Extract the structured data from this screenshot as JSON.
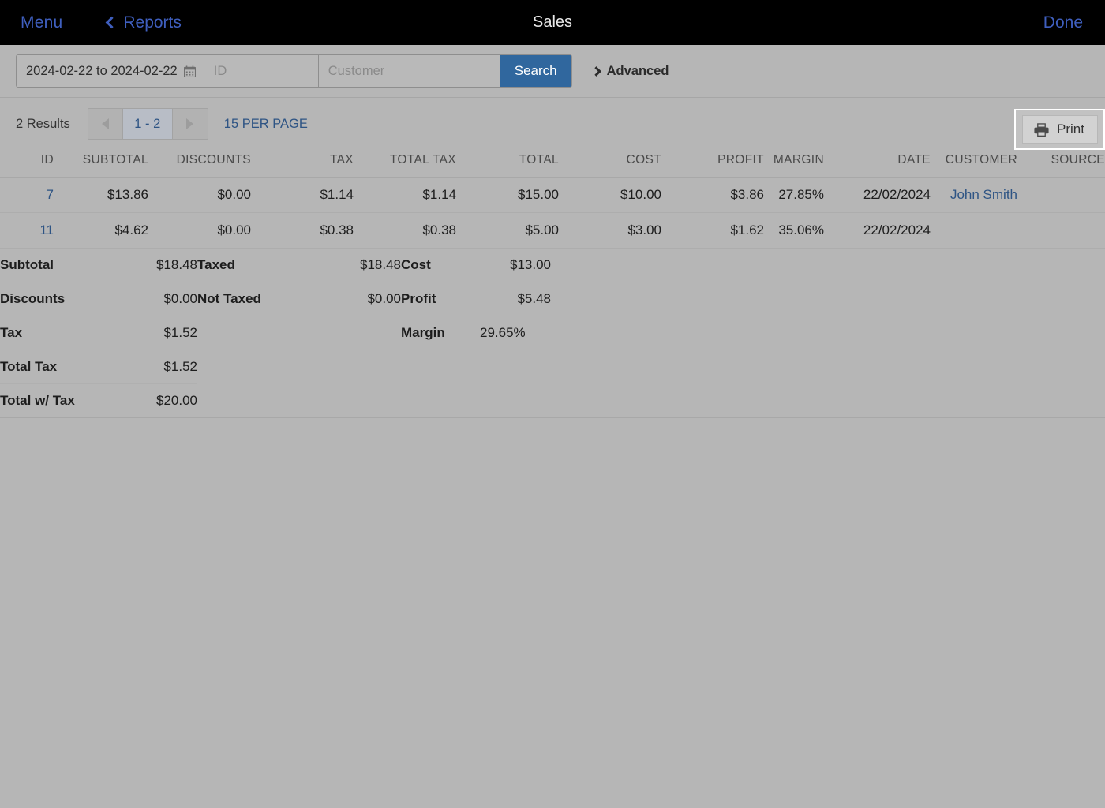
{
  "navbar": {
    "menu_label": "Menu",
    "back_label": "Reports",
    "back_icon": "chevron-left-icon",
    "title": "Sales",
    "done_label": "Done"
  },
  "search": {
    "date_range": "2024-02-22 to 2024-02-22",
    "calendar_icon": "calendar-icon",
    "id_value": "",
    "id_placeholder": "ID",
    "customer_value": "",
    "customer_placeholder": "Customer",
    "search_label": "Search",
    "advanced_label": "Advanced",
    "advanced_icon": "chevron-right-icon"
  },
  "toolbar": {
    "results_label": "2 Results",
    "prev_icon": "triangle-left-icon",
    "page_range": "1 - 2",
    "next_icon": "triangle-right-icon",
    "per_page_label": "15 PER PAGE",
    "print_label": "Print",
    "print_icon": "printer-icon"
  },
  "table": {
    "columns": [
      "ID",
      "SUBTOTAL",
      "DISCOUNTS",
      "TAX",
      "TOTAL TAX",
      "TOTAL",
      "COST",
      "PROFIT",
      "MARGIN",
      "DATE",
      "CUSTOMER",
      "SOURCE"
    ],
    "rows": [
      {
        "id": "7",
        "subtotal": "$13.86",
        "discounts": "$0.00",
        "tax": "$1.14",
        "total_tax": "$1.14",
        "total": "$15.00",
        "cost": "$10.00",
        "profit": "$3.86",
        "margin": "27.85%",
        "date": "22/02/2024",
        "customer": "John Smith",
        "source": ""
      },
      {
        "id": "11",
        "subtotal": "$4.62",
        "discounts": "$0.00",
        "tax": "$0.38",
        "total_tax": "$0.38",
        "total": "$5.00",
        "cost": "$3.00",
        "profit": "$1.62",
        "margin": "35.06%",
        "date": "22/02/2024",
        "customer": "",
        "source": ""
      }
    ]
  },
  "summary": {
    "col1": [
      {
        "label": "Subtotal",
        "value": "$18.48"
      },
      {
        "label": "Discounts",
        "value": "$0.00"
      },
      {
        "label": "Tax",
        "value": "$1.52"
      },
      {
        "label": "Total Tax",
        "value": "$1.52"
      },
      {
        "label": "Total w/ Tax",
        "value": "$20.00"
      }
    ],
    "col2": [
      {
        "label": "Taxed",
        "value": "$18.48"
      },
      {
        "label": "Not Taxed",
        "value": "$0.00"
      }
    ],
    "col3": [
      {
        "label": "Cost",
        "value": "$13.00"
      },
      {
        "label": "Profit",
        "value": "$5.48"
      },
      {
        "label": "Margin",
        "value": "29.65%"
      }
    ]
  },
  "colors": {
    "accent_blue": "#30679e",
    "link_blue": "#2e5484",
    "nav_blue": "#3f5fbf",
    "page_bg": "#b6b6b6",
    "nav_bg": "#000000"
  }
}
